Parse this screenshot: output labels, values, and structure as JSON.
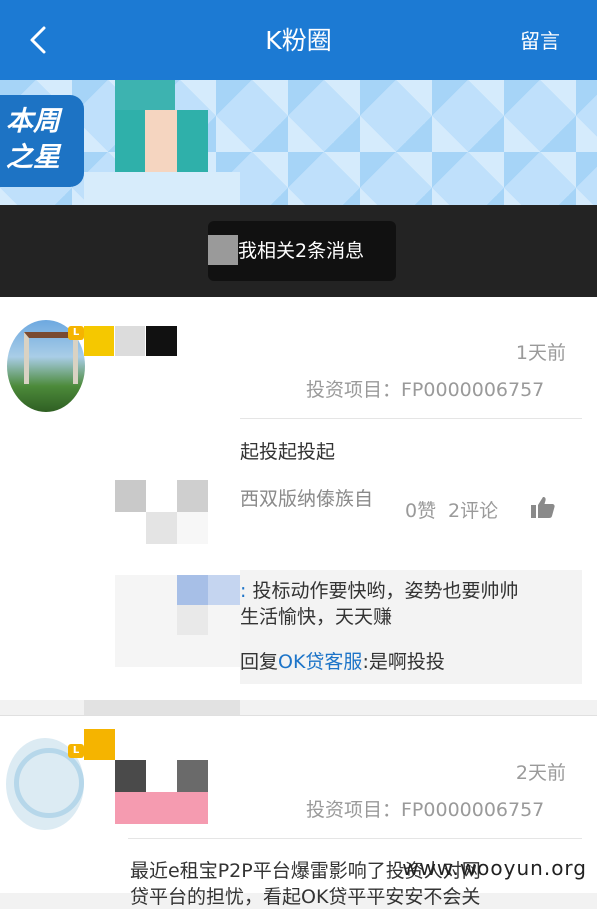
{
  "header": {
    "title": "K粉圈",
    "right_label": "留言"
  },
  "banner": {
    "badge_line1": "本周",
    "badge_line2": "之星"
  },
  "notification": {
    "text": "我相关2条消息"
  },
  "posts": [
    {
      "time": "1天前",
      "project": "投资项目：FP0000006757",
      "content": "起投起投起",
      "location": "西双版纳傣族自",
      "likes": "0赞",
      "comments": "2评论",
      "replies": [
        {
          "prefix": ":",
          "text": " 投标动作要快哟，姿势也要帅帅"
        },
        {
          "text": "生活愉快，天天赚"
        },
        {
          "prefix": "回复",
          "name": "OK贷客服",
          "suffix": ":是啊投投"
        }
      ]
    },
    {
      "time": "2天前",
      "project": "投资项目：FP0000006757",
      "content": "最近e租宝P2P平台爆雷影响了投资人对网",
      "content_line2": "贷平台的担忧，看起OK贷平平安安不会关"
    }
  ],
  "watermark": "www.wooyun.org",
  "colors": {
    "header_blue": "#1c7ad3",
    "link_blue": "#1d74c8",
    "level_badge": "#f5b400"
  }
}
